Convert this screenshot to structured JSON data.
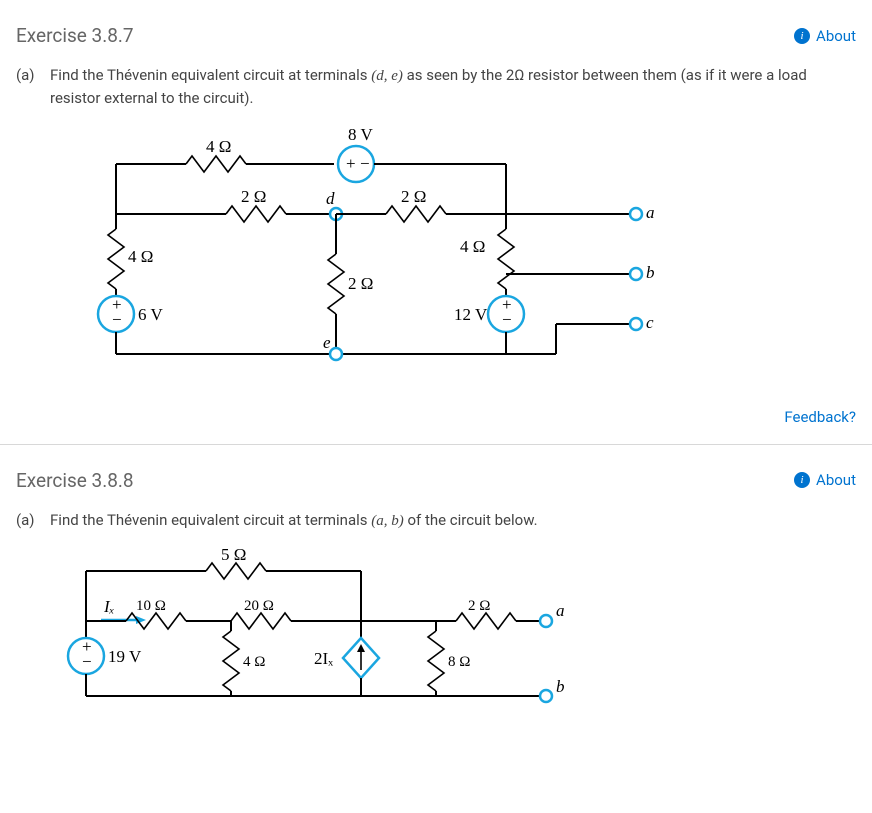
{
  "exercise1": {
    "title": "Exercise 3.8.7",
    "about": "About",
    "part_label": "(a)",
    "q_pre": "Find the Thévenin equivalent circuit at terminals ",
    "q_terms": "(d, e)",
    "q_mid": " as seen by the ",
    "q_r": "2Ω",
    "q_post": " resistor between them (as if it were a load resistor external to the circuit).",
    "feedback": "Feedback?",
    "c": {
      "r_top": "4 Ω",
      "v_top": "8 V",
      "r_2a": "2 Ω",
      "node_d": "d",
      "r_2b": "2 Ω",
      "node_a": "a",
      "r_4left": "4 Ω",
      "r_4right": "4 Ω",
      "node_b": "b",
      "r_2mid": "2 Ω",
      "v_6": "6 V",
      "v_12": "12 V",
      "node_e": "e",
      "node_c": "c"
    }
  },
  "exercise2": {
    "title": "Exercise 3.8.8",
    "about": "About",
    "part_label": "(a)",
    "q_pre": "Find the Thévenin equivalent circuit at terminals ",
    "q_terms": "(a, b)",
    "q_post": " of the circuit below.",
    "c": {
      "r_5": "5 Ω",
      "ix": "Iₓ",
      "r_10": "10 Ω",
      "r_20": "20 Ω",
      "r_2": "2 Ω",
      "node_a": "a",
      "v_19": "19 V",
      "r_4": "4 Ω",
      "dep": "2Iₓ",
      "r_8": "8 Ω",
      "node_b": "b"
    }
  }
}
